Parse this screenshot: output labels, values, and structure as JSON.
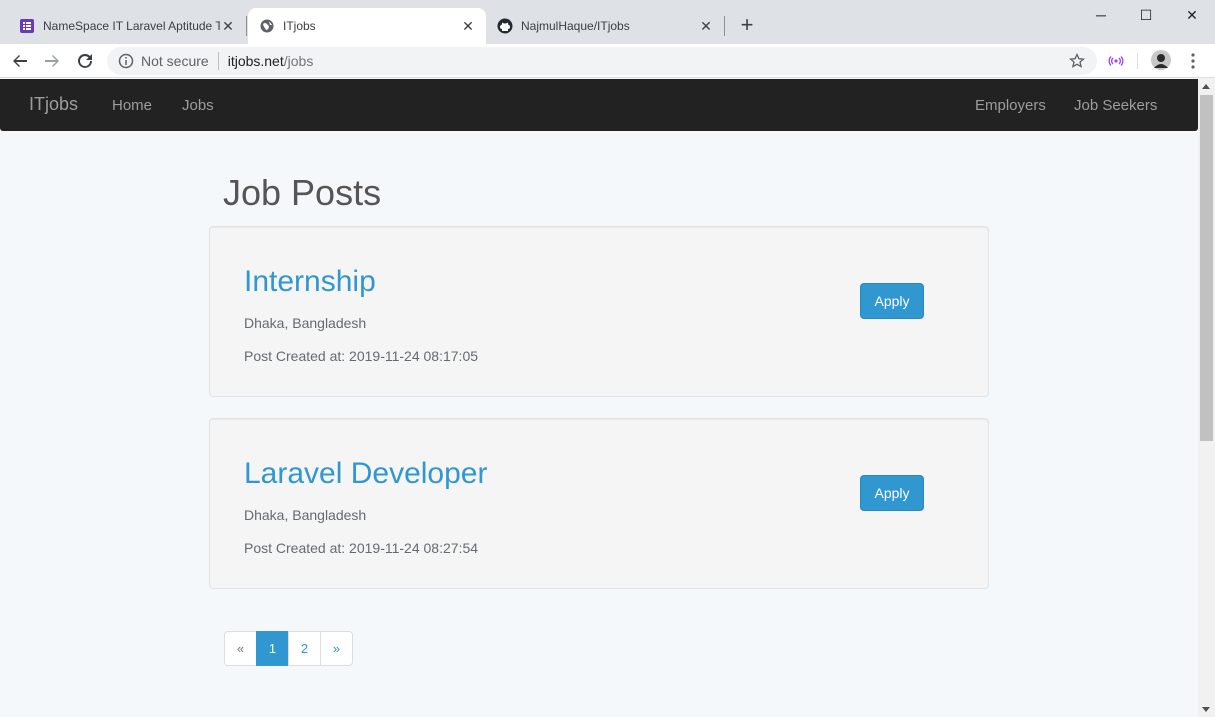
{
  "browser": {
    "tabs": [
      {
        "title": "NameSpace IT Laravel Aptitude T",
        "icon": "google-forms-icon"
      },
      {
        "title": "ITjobs",
        "icon": "globe-icon"
      },
      {
        "title": "NajmulHaque/ITjobs",
        "icon": "github-icon"
      }
    ],
    "active_tab": 1,
    "new_tab_label": "+",
    "security_label": "Not secure",
    "url_host": "itjobs.net",
    "url_path": "/jobs",
    "window_controls": {
      "minimize": "─",
      "maximize": "☐",
      "close": "✕"
    }
  },
  "navbar": {
    "brand": "ITjobs",
    "left_links": [
      "Home",
      "Jobs"
    ],
    "right_links": [
      "Employers",
      "Job Seekers"
    ]
  },
  "page": {
    "title": "Job Posts",
    "jobs": [
      {
        "title": "Internship",
        "location": "Dhaka, Bangladesh",
        "created": "Post Created at: 2019-11-24 08:17:05",
        "apply_label": "Apply"
      },
      {
        "title": "Laravel Developer",
        "location": "Dhaka, Bangladesh",
        "created": "Post Created at: 2019-11-24 08:27:54",
        "apply_label": "Apply"
      }
    ],
    "pagination": {
      "prev": "«",
      "pages": [
        "1",
        "2"
      ],
      "current": "1",
      "next": "»"
    }
  },
  "colors": {
    "navbar_bg": "#222222",
    "accent": "#3097d1",
    "page_bg": "#f5f8fa",
    "card_bg": "#f5f5f5"
  }
}
